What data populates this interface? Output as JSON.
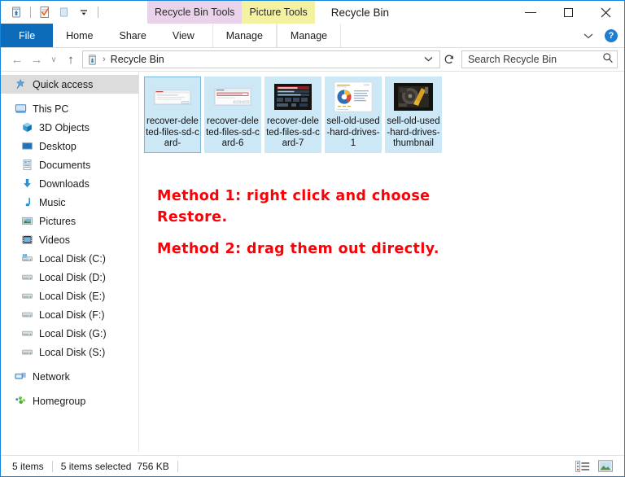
{
  "window": {
    "title": "Recycle Bin",
    "controls": {
      "minimize": "minimize-button",
      "maximize": "maximize-button",
      "close": "close-button"
    }
  },
  "quick_access_toolbar": {
    "items": [
      {
        "name": "recycle-bin-icon",
        "label": "Recycle Bin"
      },
      {
        "name": "properties-icon",
        "label": "Properties"
      },
      {
        "name": "new-folder-icon",
        "label": "New folder"
      },
      {
        "name": "customize-dropdown-icon",
        "label": "Customize Quick Access Toolbar"
      }
    ]
  },
  "contextual_tabs": [
    {
      "title": "Recycle Bin Tools",
      "tab": "Manage",
      "color": "#ebd2eb"
    },
    {
      "title": "Picture Tools",
      "tab": "Manage",
      "color": "#f4f2a0"
    }
  ],
  "ribbon": {
    "tabs": [
      {
        "label": "File",
        "active": true
      },
      {
        "label": "Home",
        "active": false
      },
      {
        "label": "Share",
        "active": false
      },
      {
        "label": "View",
        "active": false
      }
    ],
    "context_tabs": [
      {
        "label": "Manage"
      },
      {
        "label": "Manage"
      }
    ],
    "collapse_label": "Minimize the Ribbon",
    "help_label": "?"
  },
  "navigation": {
    "back": "←",
    "forward": "→",
    "recent": "∨",
    "up": "↑",
    "breadcrumb_icon": "recycle-bin-icon",
    "breadcrumb_separator": "›",
    "breadcrumb": "Recycle Bin",
    "address_dropdown": "∨",
    "refresh": "↻"
  },
  "search": {
    "placeholder": "Search Recycle Bin",
    "value": "",
    "icon": "search-icon"
  },
  "sidebar": {
    "items": [
      {
        "label": "Quick access",
        "icon": "star-pin-icon",
        "level": 0,
        "selected": true
      },
      {
        "label": "This PC",
        "icon": "monitor-icon",
        "level": 0,
        "selected": false
      },
      {
        "label": "3D Objects",
        "icon": "cube-icon",
        "level": 1,
        "selected": false
      },
      {
        "label": "Desktop",
        "icon": "desktop-icon",
        "level": 1,
        "selected": false
      },
      {
        "label": "Documents",
        "icon": "documents-icon",
        "level": 1,
        "selected": false
      },
      {
        "label": "Downloads",
        "icon": "downloads-icon",
        "level": 1,
        "selected": false
      },
      {
        "label": "Music",
        "icon": "music-note-icon",
        "level": 1,
        "selected": false
      },
      {
        "label": "Pictures",
        "icon": "pictures-icon",
        "level": 1,
        "selected": false
      },
      {
        "label": "Videos",
        "icon": "videos-icon",
        "level": 1,
        "selected": false
      },
      {
        "label": "Local Disk (C:)",
        "icon": "system-drive-icon",
        "level": 1,
        "selected": false
      },
      {
        "label": "Local Disk (D:)",
        "icon": "drive-icon",
        "level": 1,
        "selected": false
      },
      {
        "label": "Local Disk (E:)",
        "icon": "drive-icon",
        "level": 1,
        "selected": false
      },
      {
        "label": "Local Disk (F:)",
        "icon": "drive-icon",
        "level": 1,
        "selected": false
      },
      {
        "label": "Local Disk (G:)",
        "icon": "drive-icon",
        "level": 1,
        "selected": false
      },
      {
        "label": "Local Disk (S:)",
        "icon": "drive-icon",
        "level": 1,
        "selected": false
      },
      {
        "label": "Network",
        "icon": "network-icon",
        "level": 0,
        "selected": false
      },
      {
        "label": "Homegroup",
        "icon": "homegroup-icon",
        "level": 0,
        "selected": false
      }
    ]
  },
  "files": [
    {
      "name": "recover-deleted-files-sd-card-",
      "thumb": "dialog-screenshot",
      "selected": true,
      "focused": true
    },
    {
      "name": "recover-deleted-files-sd-card-6",
      "thumb": "dialog-screenshot-red",
      "selected": true,
      "focused": false
    },
    {
      "name": "recover-deleted-files-sd-card-7",
      "thumb": "dark-ui-screenshot",
      "selected": true,
      "focused": false
    },
    {
      "name": "sell-old-used-hard-drives-1",
      "thumb": "document-pie-chart",
      "selected": true,
      "focused": false
    },
    {
      "name": "sell-old-used-hard-drives-thumbnail",
      "thumb": "hard-drive-photo",
      "selected": true,
      "focused": false
    }
  ],
  "annotation": {
    "color": "#fb0007",
    "line1": "Method 1: right click and choose",
    "line2": "Restore.",
    "line3": "Method 2: drag them out directly."
  },
  "statusbar": {
    "item_count": "5 items",
    "selection": "5 items selected",
    "size": "756 KB",
    "views": [
      {
        "name": "details-view-button",
        "label": "Details view"
      },
      {
        "name": "large-icons-view-button",
        "label": "Large icons view"
      }
    ]
  },
  "colors": {
    "accent": "#0d6cb9",
    "selection": "#cce8f6",
    "selection_border": "#7ab6da",
    "window_border": "#1883d7",
    "annotation_red": "#fb0007"
  }
}
